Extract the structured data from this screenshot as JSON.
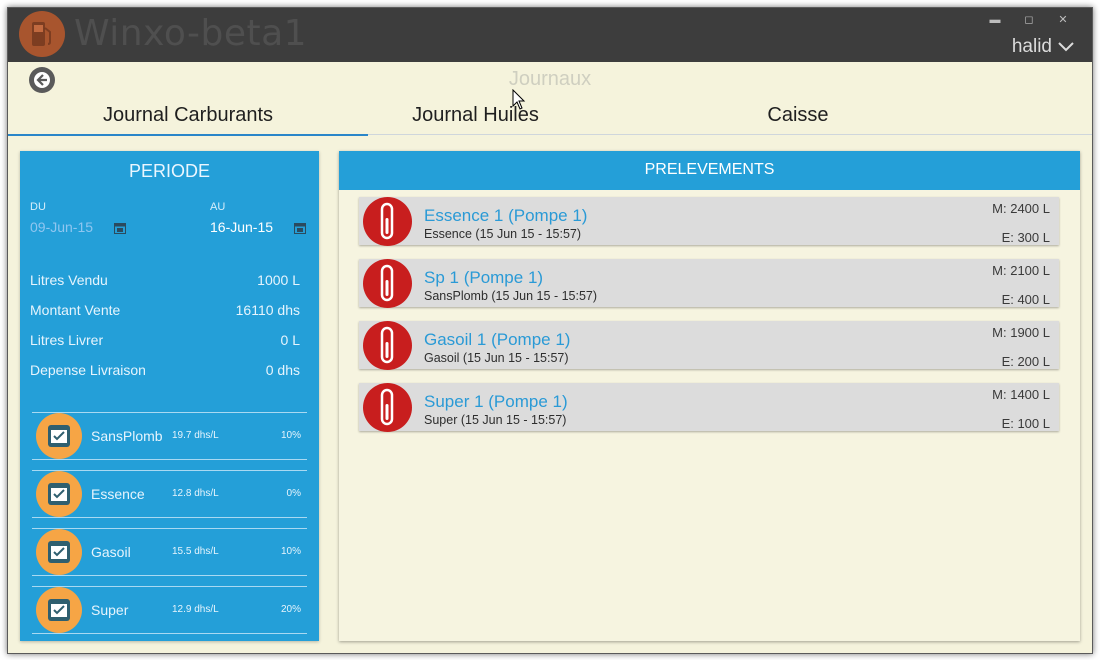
{
  "app": {
    "title": "Winxo-beta1",
    "user": "halid"
  },
  "page": {
    "title": "Journaux"
  },
  "tabs": [
    {
      "label": "Journal Carburants",
      "active": true
    },
    {
      "label": "Journal Huiles",
      "active": false
    },
    {
      "label": "Caisse",
      "active": false
    }
  ],
  "periode": {
    "title": "PERIODE",
    "du_label": "DU",
    "du_value": "09-Jun-15",
    "au_label": "AU",
    "au_value": "16-Jun-15",
    "stats": [
      {
        "label": "Litres Vendu",
        "value": "1000 L"
      },
      {
        "label": "Montant Vente",
        "value": "16110 dhs"
      },
      {
        "label": "Litres Livrer",
        "value": "0 L"
      },
      {
        "label": "Depense Livraison",
        "value": "0 dhs"
      }
    ],
    "fuels": [
      {
        "name": "SansPlomb",
        "price": "19.7 dhs/L",
        "pct": "10%"
      },
      {
        "name": "Essence",
        "price": "12.8 dhs/L",
        "pct": "0%"
      },
      {
        "name": "Gasoil",
        "price": "15.5 dhs/L",
        "pct": "10%"
      },
      {
        "name": "Super",
        "price": "12.9 dhs/L",
        "pct": "20%"
      }
    ]
  },
  "prelevements": {
    "title": "PRELEVEMENTS",
    "items": [
      {
        "title": "Essence 1 (Pompe 1)",
        "subtitle": "Essence (15 Jun 15 - 15:57)",
        "m": "M: 2400 L",
        "e": "E: 300 L"
      },
      {
        "title": "Sp 1 (Pompe 1)",
        "subtitle": "SansPlomb (15 Jun 15 - 15:57)",
        "m": "M: 2100 L",
        "e": "E: 400 L"
      },
      {
        "title": "Gasoil 1 (Pompe 1)",
        "subtitle": "Gasoil (15 Jun 15 - 15:57)",
        "m": "M: 1900 L",
        "e": "E: 200 L"
      },
      {
        "title": "Super 1 (Pompe 1)",
        "subtitle": "Super (15 Jun 15 - 15:57)",
        "m": "M: 1400 L",
        "e": "E: 100 L"
      }
    ]
  },
  "colors": {
    "accent": "#249fd8",
    "card_icon": "#c81e1e",
    "fuel_icon": "#f6a545",
    "background": "#f5f3dc"
  }
}
